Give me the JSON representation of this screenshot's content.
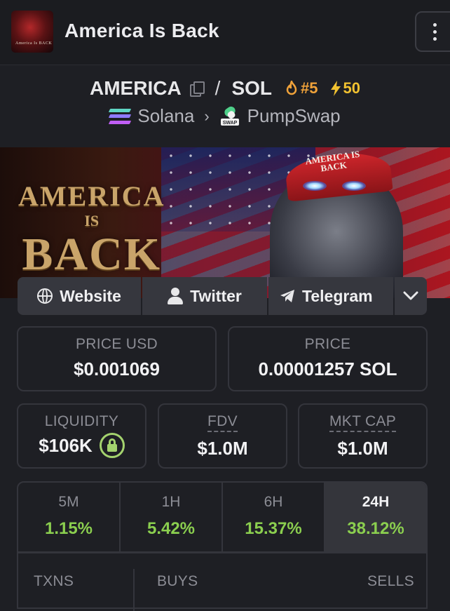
{
  "header": {
    "title": "America Is Back",
    "avatar_text": "America Is BACK",
    "menu_icon": "vertical-dots-icon"
  },
  "pair": {
    "base": "AMERICA",
    "separator": "/",
    "quote": "SOL",
    "rank": "#5",
    "boosts": "50",
    "chain": "Solana",
    "dex": "PumpSwap",
    "dex_badge": "SWAP"
  },
  "banner": {
    "line1": "AMERICA",
    "line2": "IS",
    "line3": "BACK",
    "hat_text_1": "AMERICA IS",
    "hat_text_2": "BACK"
  },
  "links": {
    "website": "Website",
    "twitter": "Twitter",
    "telegram": "Telegram"
  },
  "stats": {
    "price_usd_label": "PRICE USD",
    "price_usd": "$0.001069",
    "price_label": "PRICE",
    "price_native": "0.00001257 SOL",
    "liquidity_label": "LIQUIDITY",
    "liquidity": "$106K",
    "fdv_label": "FDV",
    "fdv": "$1.0M",
    "mktcap_label": "MKT CAP",
    "mktcap": "$1.0M"
  },
  "changes": [
    {
      "label": "5M",
      "value": "1.15%"
    },
    {
      "label": "1H",
      "value": "5.42%"
    },
    {
      "label": "6H",
      "value": "15.37%"
    },
    {
      "label": "24H",
      "value": "38.12%"
    }
  ],
  "txns": {
    "txns_label": "TXNS",
    "buys_label": "BUYS",
    "sells_label": "SELLS"
  },
  "colors": {
    "background": "#1e1f24",
    "positive": "#8bcf4f",
    "rank": "#f0a23a",
    "boost": "#f2c230"
  }
}
